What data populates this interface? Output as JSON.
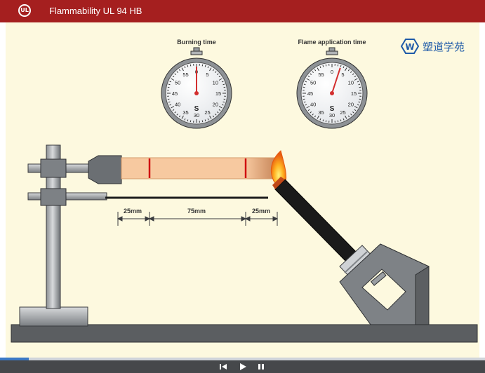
{
  "header": {
    "title": "Flammability UL 94 HB",
    "logo_text": "UL"
  },
  "brand": {
    "text": "塑道学苑"
  },
  "stopwatches": [
    {
      "label": "Burning time",
      "unit": "S",
      "ticks": [
        "0",
        "5",
        "10",
        "15",
        "20",
        "25",
        "30",
        "35",
        "40",
        "45",
        "50",
        "55"
      ],
      "hand_seconds": 0,
      "hand_color": "#d32f2f"
    },
    {
      "label": "Flame application time",
      "unit": "S",
      "ticks": [
        "0",
        "5",
        "10",
        "15",
        "20",
        "25",
        "30",
        "35",
        "40",
        "45",
        "50",
        "55"
      ],
      "hand_seconds": 3,
      "hand_color": "#d32f2f"
    }
  ],
  "measurements": {
    "left": "25mm",
    "middle": "75mm",
    "right": "25mm"
  },
  "player": {
    "progress": 0.06,
    "buttons": [
      "restart",
      "play",
      "pause"
    ]
  },
  "colors": {
    "accent": "#a51f1f",
    "stage_bg": "#fdf9df",
    "specimen": "#f7c9a0"
  }
}
